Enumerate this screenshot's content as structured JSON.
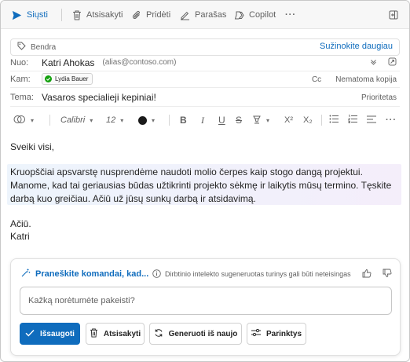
{
  "toolbar": {
    "send_label": "Siųsti",
    "discard_label": "Atsisakyti",
    "attach_label": "Pridėti",
    "signature_label": "Parašas",
    "copilot_label": "Copilot",
    "more_label": "···"
  },
  "sensitivity": {
    "label": "Bendra",
    "learn_more": "Sužinokite daugiau"
  },
  "from": {
    "label": "Nuo:",
    "name": "Katri Ahokas",
    "alias": "(alias@contoso.com)"
  },
  "to": {
    "label": "Kam:",
    "recipient": "Lydia Bauer",
    "cc": "Cc",
    "bcc": "Nematoma kopija"
  },
  "subject": {
    "label": "Tema:",
    "value": "Vasaros specialieji kepiniai!",
    "priority": "Prioritetas"
  },
  "format": {
    "font": "Calibri",
    "size": "12",
    "bold": "B",
    "italic": "I",
    "underline": "U",
    "strike": "S",
    "superscript": "X²",
    "subscript": "X₂"
  },
  "body": {
    "greeting": "Sveiki visi,",
    "paragraph": "Kruopščiai apsvarstę nusprendėme naudoti molio čerpes kaip stogo dangą projektui. Manome, kad tai geriausias būdas užtikrinti projekto sėkmę ir laikytis mūsų termino. Tęskite darbą kuo greičiau. Ačiū už jūsų sunkų darbą ir atsidavimą.",
    "thanks": "Ačiū.",
    "signature": "Katri"
  },
  "copilot": {
    "prompt_link": "Praneškite komandai, kad...",
    "disclaimer": "Dirbtinio intelekto sugeneruotas turinys gali būti neteisingas",
    "input_placeholder": "Kažką norėtumėte pakeisti?",
    "keep_label": "Išsaugoti",
    "discard_label": "Atsisakyti",
    "regenerate_label": "Generuoti iš naujo",
    "options_label": "Parinktys",
    "accent_color": "#0f6cbd"
  }
}
